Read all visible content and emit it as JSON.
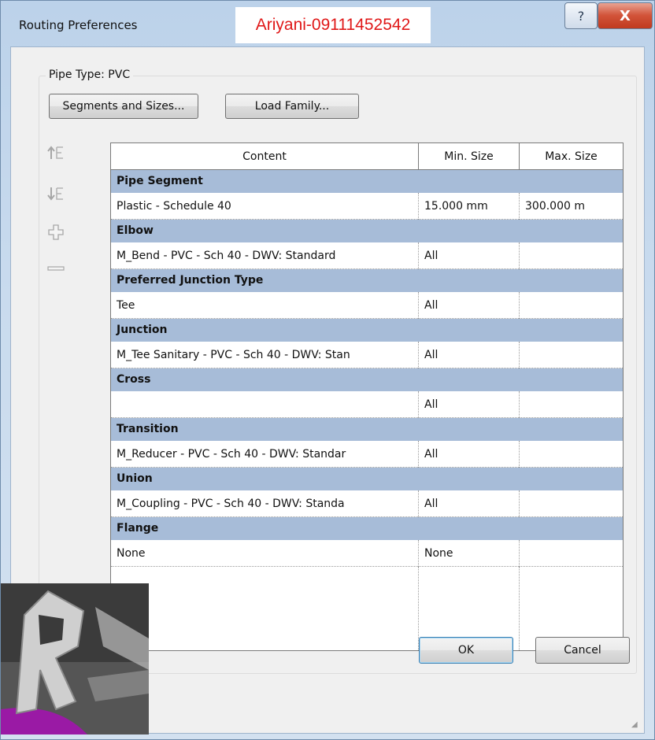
{
  "window": {
    "title": "Routing Preferences",
    "watermark": "Ariyani-09111452542",
    "help_label": "?",
    "close_label": "X"
  },
  "group": {
    "label": "Pipe Type: PVC"
  },
  "toolbar": {
    "segments_label": "Segments and Sizes...",
    "load_family_label": "Load Family..."
  },
  "side_icons": {
    "move_up": "move-up-icon",
    "move_down": "move-down-icon",
    "add": "add-icon",
    "remove": "remove-icon"
  },
  "table": {
    "headers": [
      "Content",
      "Min. Size",
      "Max. Size"
    ],
    "groups": [
      {
        "title": "Pipe Segment",
        "content": "Plastic - Schedule 40",
        "min": "15.000 mm",
        "max": "300.000 m"
      },
      {
        "title": "Elbow",
        "content": "M_Bend - PVC - Sch 40 - DWV: Standard",
        "min": "All",
        "max": ""
      },
      {
        "title": "Preferred Junction Type",
        "content": "Tee",
        "min": "All",
        "max": ""
      },
      {
        "title": "Junction",
        "content": "M_Tee Sanitary - PVC - Sch 40 - DWV: Stan",
        "min": "All",
        "max": ""
      },
      {
        "title": "Cross",
        "content": "",
        "min": "All",
        "max": ""
      },
      {
        "title": "Transition",
        "content": "M_Reducer - PVC - Sch 40 - DWV: Standar",
        "min": "All",
        "max": ""
      },
      {
        "title": "Union",
        "content": "M_Coupling - PVC - Sch 40 - DWV: Standa",
        "min": "All",
        "max": ""
      },
      {
        "title": "Flange",
        "content": "None",
        "min": "None",
        "max": ""
      }
    ]
  },
  "buttons": {
    "ok": "OK",
    "cancel": "Cancel"
  },
  "colors": {
    "group_header": "#a7bcd8",
    "watermark_text": "#e01818",
    "close_button": "#c03a1f"
  }
}
